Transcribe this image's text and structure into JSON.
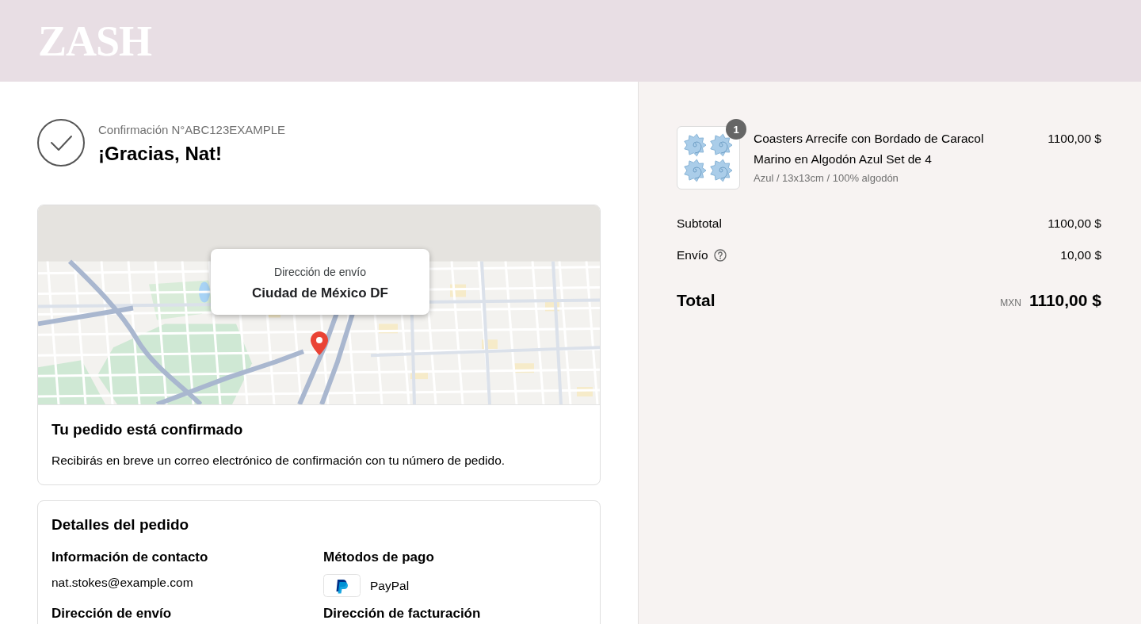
{
  "header": {
    "logo": "ZASH"
  },
  "confirmation": {
    "number": "Confirmación N°ABC123EXAMPLE",
    "greeting": "¡Gracias, Nat!"
  },
  "map": {
    "tooltip_label": "Dirección de envío",
    "tooltip_value": "Ciudad de México DF"
  },
  "status": {
    "title": "Tu pedido está confirmado",
    "message": "Recibirás en breve un correo electrónico de confirmación con tu número de pedido."
  },
  "details": {
    "title": "Detalles del pedido",
    "sections": [
      {
        "kind": "contact",
        "heading": "Información de contacto",
        "value": "nat.stokes@example.com"
      },
      {
        "kind": "payment",
        "heading": "Métodos de pago",
        "value": "PayPal"
      },
      {
        "kind": "address",
        "heading": "Dirección de envío"
      },
      {
        "kind": "address",
        "heading": "Dirección de facturación"
      }
    ]
  },
  "summary": {
    "items": [
      {
        "quantity": "1",
        "name": "Coasters Arrecife con Bordado de Caracol Marino en Algodón Azul Set de 4",
        "variant": "Azul / 13x13cm / 100% algodón",
        "price": "1100,00 $"
      }
    ],
    "lines": [
      {
        "label": "Subtotal",
        "value": "1100,00 $",
        "help": false
      },
      {
        "label": "Envío",
        "value": "10,00 $",
        "help": true
      }
    ],
    "total": {
      "label": "Total",
      "currency": "MXN",
      "value": "1110,00 $"
    }
  }
}
